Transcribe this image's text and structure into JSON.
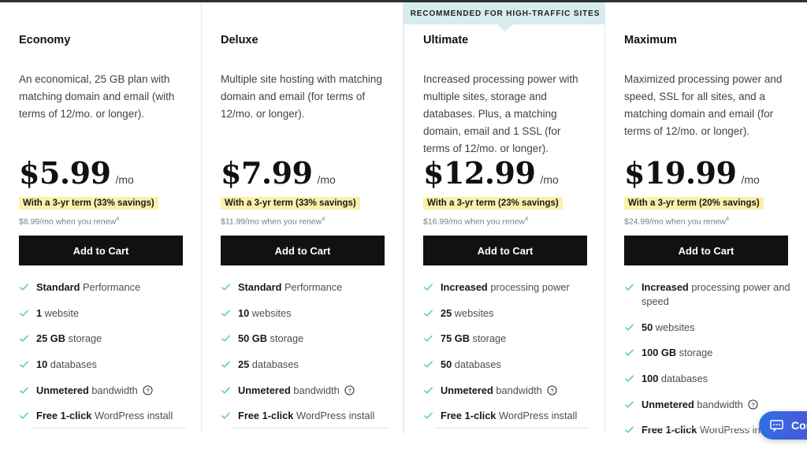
{
  "colors": {
    "accent_check": "#5fc8cd",
    "ribbon_bg": "#d6eced",
    "savings_bg": "#fdf0a8",
    "cta_bg": "#111111",
    "chat_gradient_start": "#2f6fe4",
    "chat_gradient_end": "#6f4fd0"
  },
  "ribbon": {
    "label": "RECOMMENDED FOR HIGH-TRAFFIC SITES"
  },
  "chat": {
    "label": "Contact",
    "icon": "chat-bubble-icon"
  },
  "common": {
    "cta_label": "Add to Cart",
    "per_month": "/mo",
    "help_icon": "question-circle-icon",
    "check_icon": "check-icon"
  },
  "plans": [
    {
      "name": "Economy",
      "description": "An economical, 25 GB plan with matching domain and email (with terms of 12/mo. or longer).",
      "price": "$5.99",
      "per": "/mo",
      "savings": "With a 3-yr term (33% savings)",
      "renew": "$8.99/mo when you renew",
      "renew_sup": "4",
      "cta": "Add to Cart",
      "featured": false,
      "features": [
        {
          "strong": "Standard",
          "rest": " Performance",
          "help": false
        },
        {
          "strong": "1",
          "rest": " website",
          "help": false
        },
        {
          "strong": "25 GB",
          "rest": " storage",
          "help": false
        },
        {
          "strong": "10",
          "rest": " databases",
          "help": false
        },
        {
          "strong": "Unmetered",
          "rest": " bandwidth",
          "help": true
        },
        {
          "strong": "Free 1-click",
          "rest": " WordPress install",
          "help": false
        }
      ]
    },
    {
      "name": "Deluxe",
      "description": "Multiple site hosting with matching domain and email (for terms of 12/mo. or longer).",
      "price": "$7.99",
      "per": "/mo",
      "savings": "With a 3-yr term (33% savings)",
      "renew": "$11.99/mo when you renew",
      "renew_sup": "4",
      "cta": "Add to Cart",
      "featured": false,
      "features": [
        {
          "strong": "Standard",
          "rest": " Performance",
          "help": false
        },
        {
          "strong": "10",
          "rest": " websites",
          "help": false
        },
        {
          "strong": "50 GB",
          "rest": " storage",
          "help": false
        },
        {
          "strong": "25",
          "rest": " databases",
          "help": false
        },
        {
          "strong": "Unmetered",
          "rest": " bandwidth",
          "help": true
        },
        {
          "strong": "Free 1-click",
          "rest": " WordPress install",
          "help": false
        }
      ]
    },
    {
      "name": "Ultimate",
      "description": "Increased processing power with multiple sites, storage and databases. Plus, a matching domain, email and 1 SSL (for terms of 12/mo. or longer).",
      "price": "$12.99",
      "per": "/mo",
      "savings": "With a 3-yr term (23% savings)",
      "renew": "$16.99/mo when you renew",
      "renew_sup": "4",
      "cta": "Add to Cart",
      "featured": true,
      "features": [
        {
          "strong": "Increased",
          "rest": " processing power",
          "help": false
        },
        {
          "strong": "25",
          "rest": " websites",
          "help": false
        },
        {
          "strong": "75 GB",
          "rest": " storage",
          "help": false
        },
        {
          "strong": "50",
          "rest": " databases",
          "help": false
        },
        {
          "strong": "Unmetered",
          "rest": " bandwidth",
          "help": true
        },
        {
          "strong": "Free 1-click",
          "rest": " WordPress install",
          "help": false
        }
      ]
    },
    {
      "name": "Maximum",
      "description": "Maximized processing power and speed, SSL for all sites, and a matching domain and email (for terms of 12/mo. or longer).",
      "price": "$19.99",
      "per": "/mo",
      "savings": "With a 3-yr term (20% savings)",
      "renew": "$24.99/mo when you renew",
      "renew_sup": "4",
      "cta": "Add to Cart",
      "featured": false,
      "features": [
        {
          "strong": "Increased",
          "rest": " processing power and speed",
          "help": false
        },
        {
          "strong": "50",
          "rest": " websites",
          "help": false
        },
        {
          "strong": "100 GB",
          "rest": " storage",
          "help": false
        },
        {
          "strong": "100",
          "rest": " databases",
          "help": false
        },
        {
          "strong": "Unmetered",
          "rest": " bandwidth",
          "help": true
        },
        {
          "strong": "Free 1-click",
          "rest": " WordPress install",
          "help": false
        }
      ]
    }
  ]
}
